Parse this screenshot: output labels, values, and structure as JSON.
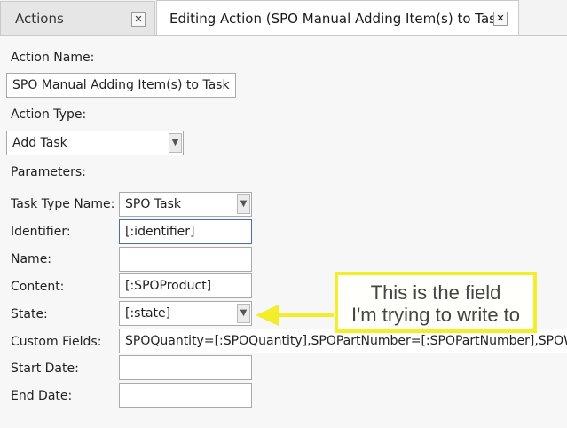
{
  "tabs": [
    {
      "label": "Actions",
      "close": "✕"
    },
    {
      "label": "Editing Action (SPO Manual Adding Item(s) to Task)",
      "close": "✕"
    }
  ],
  "form": {
    "action_name_label": "Action Name:",
    "action_name_value": "SPO Manual Adding Item(s) to Task",
    "action_type_label": "Action Type:",
    "action_type_value": "Add Task",
    "parameters_label": "Parameters:",
    "task_type_name_label": "Task Type Name:",
    "task_type_name_value": "SPO Task",
    "identifier_label": "Identifier:",
    "identifier_value": "[:identifier]",
    "name_label": "Name:",
    "name_value": "",
    "content_label": "Content:",
    "content_value": "[:SPOProduct]",
    "state_label": "State:",
    "state_value": "[:state]",
    "custom_fields_label": "Custom Fields:",
    "custom_fields_value": "SPOQuantity=[:SPOQuantity],SPOPartNumber=[:SPOPartNumber],SPOWeight=[:SPOWeight]",
    "start_date_label": "Start Date:",
    "start_date_value": "",
    "end_date_label": "End Date:",
    "end_date_value": ""
  },
  "annotation": {
    "line1": "This is the field",
    "line2": "I'm trying to write to",
    "color": "#f2ee2a"
  },
  "icons": {
    "dropdown": "chevron-down-icon",
    "close": "close-icon"
  }
}
